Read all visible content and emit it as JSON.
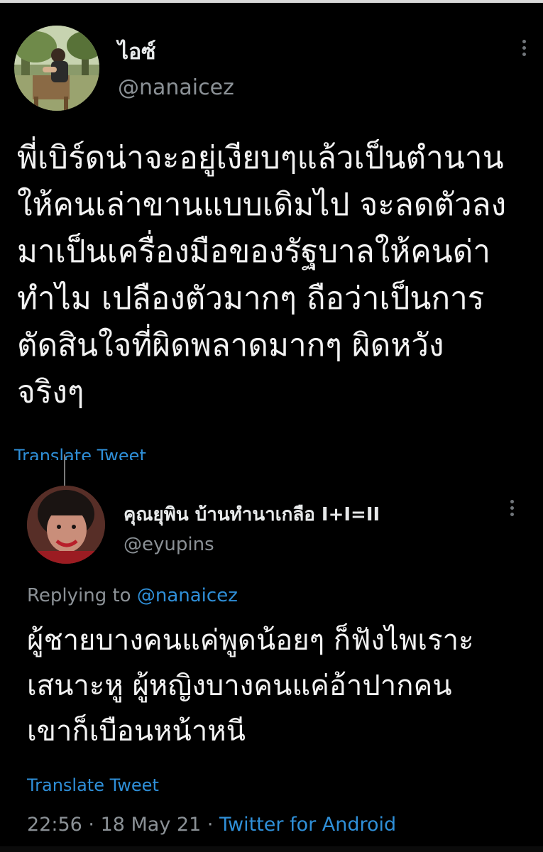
{
  "tweet": {
    "author_name": "ไอซ์",
    "author_handle": "@nanaicez",
    "text_lines": [
      "พี่เบิร์ดน่าจะอยู่เงียบๆแล้วเป็นตำนาน",
      "ให้คนเล่าขานแบบเดิมไป จะลดตัวลง",
      "มาเป็นเครื่องมือของรัฐบาลให้คนด่า",
      "ทำไม เปลืองตัวมากๆ ถือว่าเป็นการ",
      "ตัดสินใจที่ผิดพลาดมากๆ ผิดหวัง",
      "จริงๆ"
    ],
    "translate_label": "Translate Tweet",
    "more_icon": "more-vertical-icon"
  },
  "reply": {
    "author_name": "คุณยุพิน บ้านทำนาเกลือ I+I=II",
    "author_handle": "@eyupins",
    "replying_prefix": "Replying to ",
    "replying_mention": "@nanaicez",
    "text_lines": [
      "ผู้ชายบางคนแค่พูดน้อยๆ ก็ฟังไพเราะ",
      "เสนาะหู ผู้หญิงบางคนแค่อ้าปากคน",
      "เขาก็เบือนหน้าหนี"
    ],
    "translate_label": "Translate Tweet",
    "time": "22:56",
    "separator": " · ",
    "date": "18 May 21",
    "source": "Twitter for Android",
    "more_icon": "more-vertical-icon"
  },
  "colors": {
    "background": "#000000",
    "text": "#f2f2f2",
    "secondary": "#8b9196",
    "link": "#2f8fd8"
  }
}
